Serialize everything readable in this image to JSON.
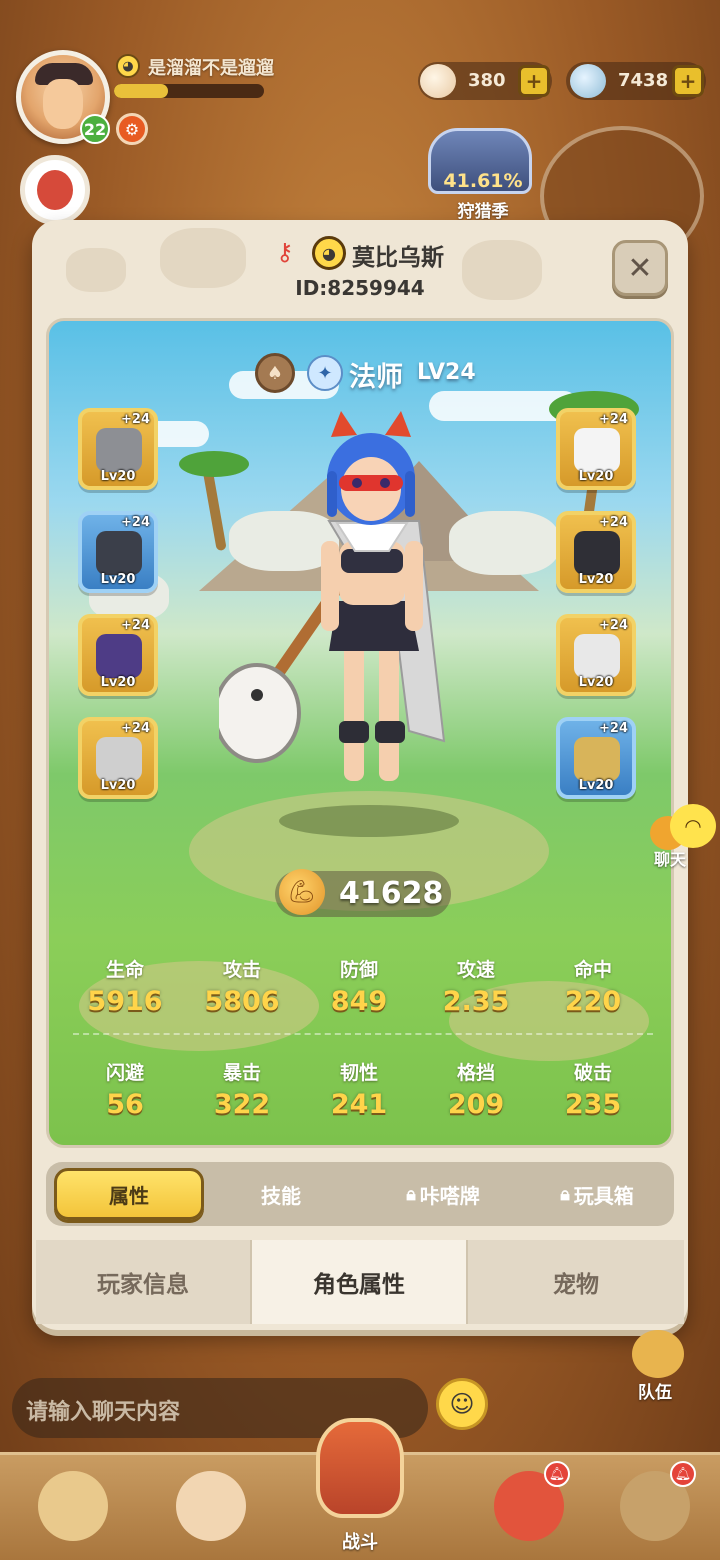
{
  "hud": {
    "player_name": "是溜溜不是遛遛",
    "player_level": "22",
    "exp_fraction": 0.36,
    "shells": "380",
    "gems": "7438",
    "season_percent": "41.61%",
    "season_label": "狩猎季"
  },
  "profile": {
    "name": "莫比乌斯",
    "id_text": "ID:8259944"
  },
  "character": {
    "class_name": "法师",
    "level_text": "LV24",
    "power": "41628"
  },
  "equipment": {
    "left": [
      {
        "plus": "+24",
        "level": "Lv20",
        "rarity": "gold",
        "item_icon": "cat-scarf-icon"
      },
      {
        "plus": "+24",
        "level": "Lv20",
        "rarity": "blue",
        "item_icon": "goggles-icon"
      },
      {
        "plus": "+24",
        "level": "Lv20",
        "rarity": "gold",
        "item_icon": "bracer-icon"
      },
      {
        "plus": "+24",
        "level": "Lv20",
        "rarity": "gold",
        "item_icon": "ring-icon"
      }
    ],
    "right": [
      {
        "plus": "+24",
        "level": "Lv20",
        "rarity": "gold",
        "item_icon": "pearl-icon"
      },
      {
        "plus": "+24",
        "level": "Lv20",
        "rarity": "gold",
        "item_icon": "armor-icon"
      },
      {
        "plus": "+24",
        "level": "Lv20",
        "rarity": "gold",
        "item_icon": "glove-icon"
      },
      {
        "plus": "+24",
        "level": "Lv20",
        "rarity": "blue",
        "item_icon": "necklace-icon"
      }
    ]
  },
  "stats": {
    "row1": [
      {
        "label": "生命",
        "value": "5916"
      },
      {
        "label": "攻击",
        "value": "5806"
      },
      {
        "label": "防御",
        "value": "849"
      },
      {
        "label": "攻速",
        "value": "2.35"
      },
      {
        "label": "命中",
        "value": "220"
      }
    ],
    "row2": [
      {
        "label": "闪避",
        "value": "56"
      },
      {
        "label": "暴击",
        "value": "322"
      },
      {
        "label": "韧性",
        "value": "241"
      },
      {
        "label": "格挡",
        "value": "209"
      },
      {
        "label": "破击",
        "value": "235"
      }
    ]
  },
  "sub_tabs": [
    {
      "label": "属性",
      "active": true,
      "locked": false
    },
    {
      "label": "技能",
      "active": false,
      "locked": false
    },
    {
      "label": "咔嗒牌",
      "active": false,
      "locked": true
    },
    {
      "label": "玩具箱",
      "active": false,
      "locked": true
    }
  ],
  "bottom_tabs": [
    {
      "label": "玩家信息"
    },
    {
      "label": "角色属性"
    },
    {
      "label": "宠物"
    }
  ],
  "chat": {
    "bubble_label": "聊天",
    "input_placeholder": "请输入聊天内容"
  },
  "team_label": "队伍",
  "battle_label": "战斗",
  "colors": {
    "accent_gold": "#f3c43a",
    "stat_value": "#ffd44a",
    "rarity_blue": "#3a7fc4",
    "rarity_gold": "#d69a2a"
  }
}
